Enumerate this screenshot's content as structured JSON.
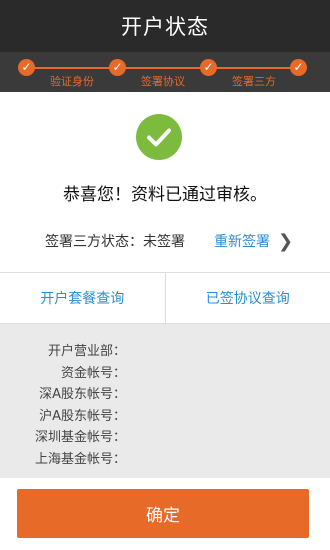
{
  "header": {
    "title": "开户状态"
  },
  "steps": [
    {
      "label": "验证身份",
      "icon": "check-icon"
    },
    {
      "label": "签署协议",
      "icon": "check-icon"
    },
    {
      "label": "签署三方",
      "icon": "check-icon"
    }
  ],
  "success": {
    "icon": "checkmark-circle-icon",
    "message": "恭喜您！资料已通过审核。",
    "status_text": "签署三方状态：未签署",
    "resign_label": "重新签署",
    "chevron_glyph": "❯"
  },
  "queries": {
    "package_label": "开户套餐查询",
    "agreement_label": "已签协议查询"
  },
  "info": {
    "rows": [
      {
        "label": "开户营业部：",
        "value": ""
      },
      {
        "label": "资金帐号：",
        "value": ""
      },
      {
        "label": "深A股东帐号：",
        "value": ""
      },
      {
        "label": "沪A股东帐号：",
        "value": ""
      },
      {
        "label": "深圳基金帐号：",
        "value": ""
      },
      {
        "label": "上海基金帐号：",
        "value": ""
      }
    ]
  },
  "footer": {
    "confirm_label": "确定"
  },
  "colors": {
    "accent": "#e86a28",
    "link": "#2a8fd0",
    "success": "#7dbb3e",
    "header_bg": "#2a2a2a"
  }
}
